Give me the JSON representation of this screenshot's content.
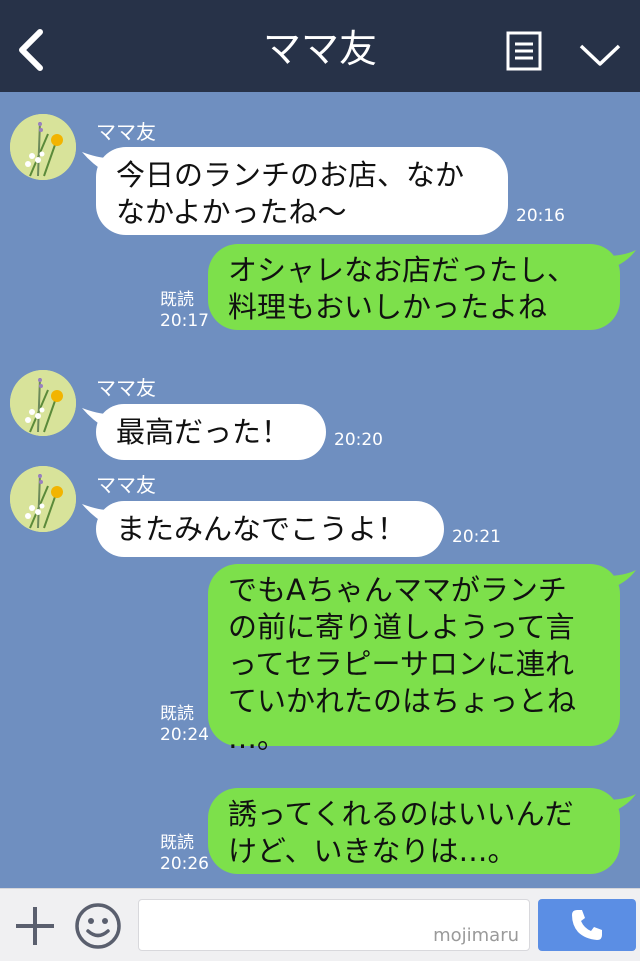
{
  "header": {
    "title": "ママ友"
  },
  "messages": {
    "m1": {
      "sender": "ママ友",
      "text1": "今日のランチのお店、なか",
      "text2": "なかよかったね〜",
      "time": "20:16"
    },
    "m2": {
      "read": "既読",
      "text1": "オシャレなお店だったし、",
      "text2": "料理もおいしかったよね",
      "time": "20:17"
    },
    "m3": {
      "sender": "ママ友",
      "text1": "最高だった！",
      "time": "20:20"
    },
    "m4": {
      "sender": "ママ友",
      "text1": "またみんなでこうよ！",
      "time": "20:21"
    },
    "m5": {
      "read": "既読",
      "text1": "でもAちゃんママがランチ",
      "text2": "の前に寄り道しようって言",
      "text3": "ってセラピーサロンに連れ",
      "text4": "ていかれたのはちょっとね",
      "text5": "…。",
      "time": "20:24"
    },
    "m6": {
      "read": "既読",
      "text1": "誘ってくれるのはいいんだ",
      "text2": "けど、いきなりは…。",
      "time": "20:26"
    }
  },
  "input": {
    "watermark": "mojimaru",
    "placeholder": ""
  },
  "colors": {
    "header": "#273248",
    "chat_bg": "#6f8fc0",
    "incoming": "#ffffff",
    "outgoing": "#7de04b",
    "call_button": "#5b8ee4"
  },
  "icons": [
    "back-chevron-icon",
    "menu-list-icon",
    "chevron-down-icon",
    "plus-icon",
    "smiley-icon",
    "phone-icon"
  ]
}
